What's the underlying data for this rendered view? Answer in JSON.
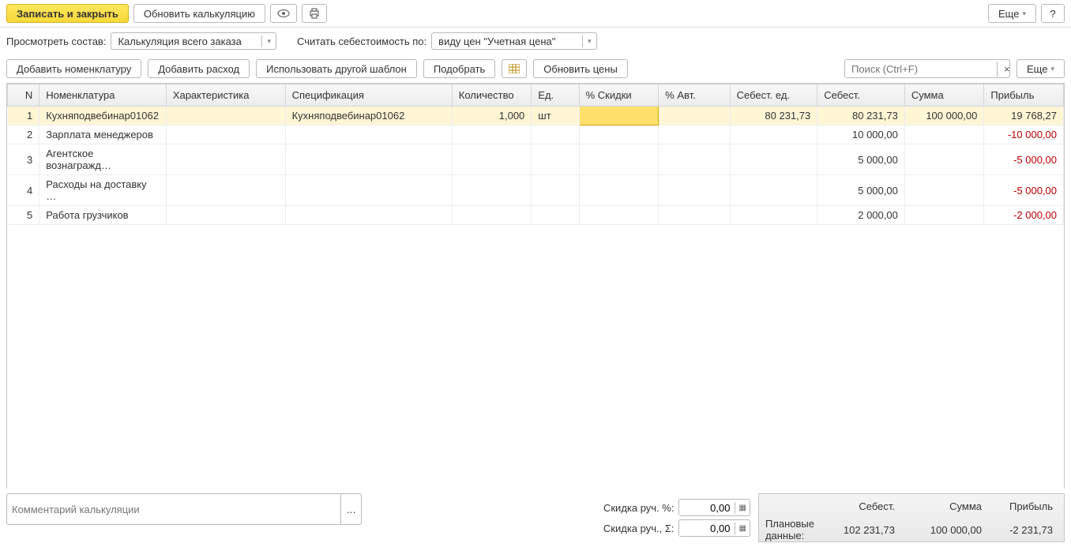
{
  "toolbar": {
    "save_close": "Записать и закрыть",
    "update_calc": "Обновить калькуляцию",
    "more": "Еще",
    "help": "?"
  },
  "filters": {
    "view_label": "Просмотреть состав:",
    "view_value": "Калькуляция всего заказа",
    "cost_label": "Считать себестоимость по:",
    "cost_value": "виду цен \"Учетная цена\""
  },
  "actions": {
    "add_nom": "Добавить номенклатуру",
    "add_exp": "Добавить расход",
    "use_tpl": "Использовать другой шаблон",
    "select": "Подобрать",
    "update_prices": "Обновить цены",
    "search_placeholder": "Поиск (Ctrl+F)",
    "more": "Еще"
  },
  "columns": {
    "n": "N",
    "nom": "Номенклатура",
    "char": "Характеристика",
    "spec": "Спецификация",
    "qty": "Количество",
    "ed": "Ед.",
    "disc": "% Скидки",
    "avt": "% Авт.",
    "sebed": "Себест. ед.",
    "seb": "Себест.",
    "sum": "Сумма",
    "prof": "Прибыль"
  },
  "rows": [
    {
      "n": "1",
      "nom": "Кухняподвебинар01062",
      "spec": "Кухняподвебинар01062",
      "qty": "1,000",
      "ed": "шт",
      "sebed": "80 231,73",
      "seb": "80 231,73",
      "sum": "100 000,00",
      "prof": "19 768,27",
      "neg": false,
      "selected": true
    },
    {
      "n": "2",
      "nom": "Зарплата менеджеров",
      "spec": "",
      "qty": "",
      "ed": "",
      "sebed": "",
      "seb": "10 000,00",
      "sum": "",
      "prof": "-10 000,00",
      "neg": true,
      "selected": false
    },
    {
      "n": "3",
      "nom": "Агентское вознагражд…",
      "spec": "",
      "qty": "",
      "ed": "",
      "sebed": "",
      "seb": "5 000,00",
      "sum": "",
      "prof": "-5 000,00",
      "neg": true,
      "selected": false
    },
    {
      "n": "4",
      "nom": "Расходы на доставку …",
      "spec": "",
      "qty": "",
      "ed": "",
      "sebed": "",
      "seb": "5 000,00",
      "sum": "",
      "prof": "-5 000,00",
      "neg": true,
      "selected": false
    },
    {
      "n": "5",
      "nom": "Работа грузчиков",
      "spec": "",
      "qty": "",
      "ed": "",
      "sebed": "",
      "seb": "2 000,00",
      "sum": "",
      "prof": "-2 000,00",
      "neg": true,
      "selected": false
    }
  ],
  "footer": {
    "comment_placeholder": "Комментарий калькуляции",
    "disc_pct_label": "Скидка руч. %:",
    "disc_pct_value": "0,00",
    "disc_sum_label": "Скидка руч., Σ:",
    "disc_sum_value": "0,00",
    "totals": {
      "col1": "Себест.",
      "col2": "Сумма",
      "col3": "Прибыль",
      "row_label": "Плановые данные:",
      "seb": "102 231,73",
      "sum": "100 000,00",
      "prof": "-2 231,73"
    }
  }
}
